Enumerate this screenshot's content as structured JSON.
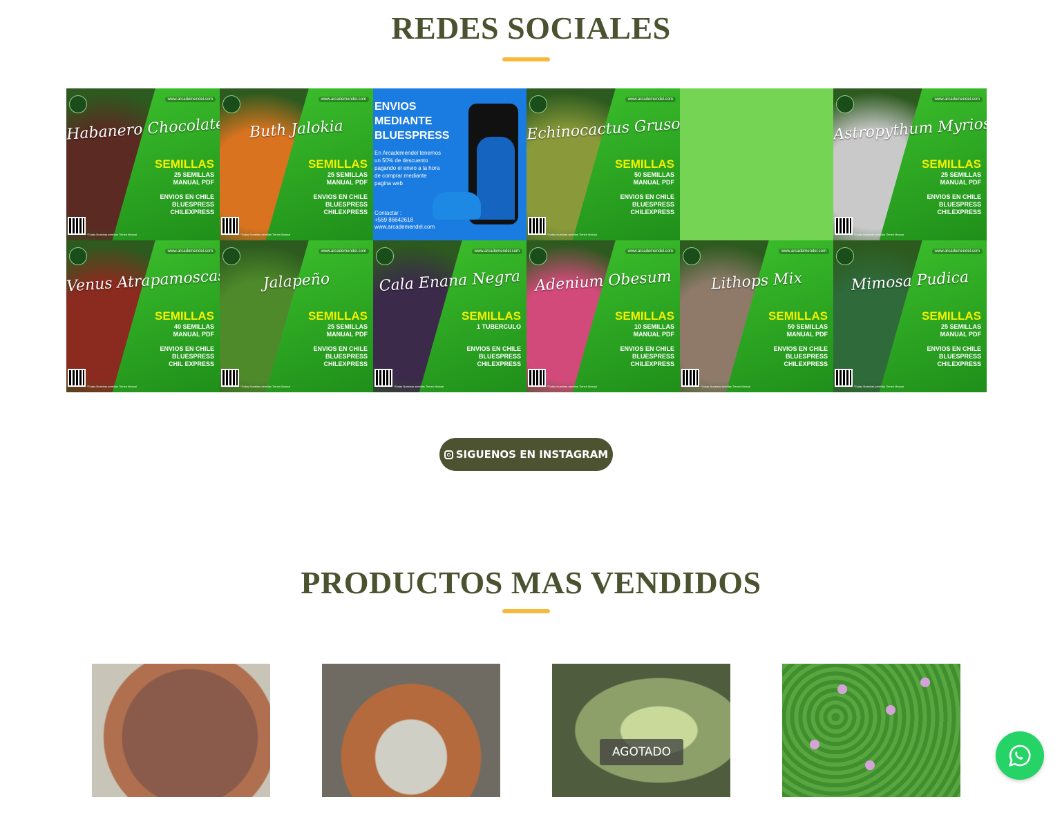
{
  "social": {
    "title": "REDES SOCIALES",
    "posts": [
      {
        "script": "Habanero Chocolate",
        "big": "SEMILLAS",
        "qty": "25 SEMILLAS\nMANUAL PDF",
        "ship": "ENVIOS EN CHILE\nBLUESPRESS\nCHILEXPRESS",
        "photo": "#5b2a22"
      },
      {
        "script": "Buth Jalokia",
        "big": "SEMILLAS",
        "qty": "25 SEMILLAS\nMANUAL PDF",
        "ship": "ENVIOS EN CHILE\nBLUESPRESS\nCHILEXPRESS",
        "photo": "#d9731f"
      },
      {
        "kind": "blue",
        "head": "ENVIOS\nMEDIANTE\nBLUESPRESS",
        "body": "En Arcademendel tenemos un 50% de descuento pagando el envio a la hora de comprar mediante pagina web",
        "contact": "Contactar :\n+569 86642618\nwww.arcademendel.com"
      },
      {
        "script": "Echinocactus Grusonii",
        "big": "SEMILLAS",
        "qty": "50 SEMILLAS\nMANUAL PDF",
        "ship": "ENVIOS EN CHILE\nBLUESPRESS\nCHILEXPRESS",
        "photo": "#8a9a3a"
      },
      {
        "kind": "plain"
      },
      {
        "script": "Astropythum Myriostigame",
        "big": "SEMILLAS",
        "qty": "25 SEMILLAS\nMANUAL PDF",
        "ship": "ENVIOS EN CHILE\nBLUESPRESS\nCHILEXPRESS",
        "photo": "#c9c9c9"
      },
      {
        "script": "Venus Atrapamoscas",
        "big": "SEMILLAS",
        "qty": "40 SEMILLAS\nMANUAL PDF",
        "ship": "ENVIOS EN CHILE\nBLUESPRESS\nCHIL EXPRESS",
        "photo": "#8b2a1f"
      },
      {
        "script": "Jalapeño",
        "big": "SEMILLAS",
        "qty": "25 SEMILLAS\nMANUAL PDF",
        "ship": "ENVIOS EN CHILE\nBLUESPRESS\nCHILEXPRESS",
        "photo": "#4f8a2a"
      },
      {
        "script": "Cala Enana Negra",
        "big": "SEMILLAS",
        "qty": "1 TUBERCULO",
        "ship": "ENVIOS EN CHILE\nBLUESPRESS\nCHILEXPRESS",
        "photo": "#3b2a4a"
      },
      {
        "script": "Adenium Obesum",
        "big": "SEMILLAS",
        "qty": "10 SEMILLAS\nMANUAL PDF",
        "ship": "ENVIOS EN CHILE\nBLUESPRESS\nCHILEXPRESS",
        "photo": "#d24a7a"
      },
      {
        "script": "Lithops Mix",
        "big": "SEMILLAS",
        "qty": "50 SEMILLAS\nMANUAL PDF",
        "ship": "ENVIOS EN CHILE\nBLUESPRESS\nCHILEXPRESS",
        "photo": "#8f7a6a"
      },
      {
        "script": "Mimosa Pudica",
        "big": "SEMILLAS",
        "qty": "25 SEMILLAS\nMANUAL PDF",
        "ship": "ENVIOS EN CHILE\nBLUESPRESS\nCHILEXPRESS",
        "photo": "#2f6a3a"
      }
    ],
    "url_text": "www.arcademendel.com",
    "note_text": "*Todas Nuestras semillas Tienen Manual",
    "button_label": "SIGUENOS EN INSTAGRAM"
  },
  "products": {
    "title": "PRODUCTOS MAS VENDIDOS",
    "sold_out_label": "AGOTADO"
  },
  "colors": {
    "title": "#4a5230",
    "accent": "#f6b93b",
    "button": "#4d5330",
    "whatsapp": "#25d366"
  },
  "icons": {
    "instagram": "instagram-icon",
    "whatsapp": "whatsapp-icon"
  }
}
